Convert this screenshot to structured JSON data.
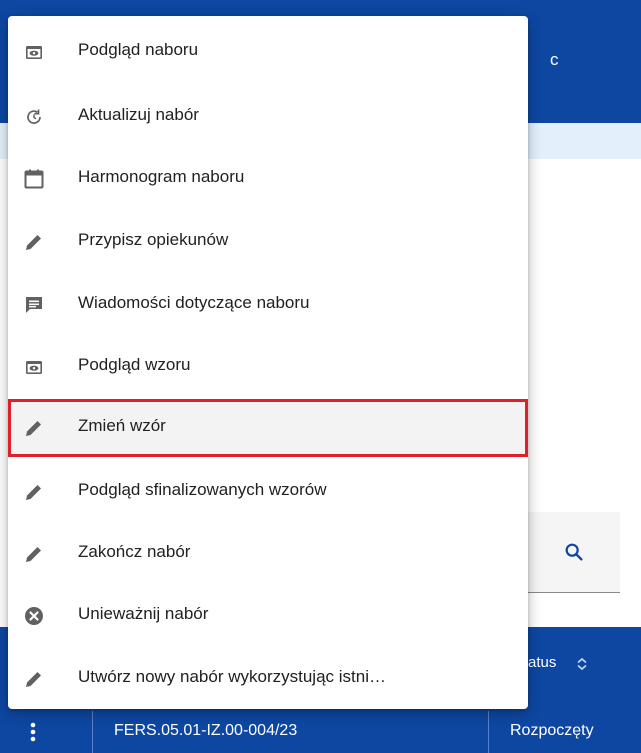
{
  "background": {
    "header_text": "c",
    "table_header": {
      "status_label": "atus"
    },
    "table_row": {
      "code": "FERS.05.01-IZ.00-004/23",
      "status": "Rozpoczęty"
    },
    "search_icon": "search-icon"
  },
  "menu": {
    "items": [
      {
        "label": "Podgląd naboru",
        "icon": "preview-icon"
      },
      {
        "label": "Aktualizuj nabór",
        "icon": "refresh-icon"
      },
      {
        "label": "Harmonogram naboru",
        "icon": "calendar-icon"
      },
      {
        "label": "Przypisz opiekunów",
        "icon": "pencil-icon"
      },
      {
        "label": "Wiadomości dotyczące naboru",
        "icon": "message-icon"
      },
      {
        "label": "Podgląd wzoru",
        "icon": "preview-icon"
      },
      {
        "label": "Zmień wzór",
        "icon": "pencil-icon",
        "highlighted": true
      },
      {
        "label": "Podgląd sfinalizowanych wzorów",
        "icon": "pencil-icon"
      },
      {
        "label": "Zakończ nabór",
        "icon": "pencil-icon"
      },
      {
        "label": "Unieważnij nabór",
        "icon": "cancel-circle-icon"
      },
      {
        "label": "Utwórz nowy nabór wykorzystując istni…",
        "icon": "pencil-icon"
      }
    ]
  },
  "colors": {
    "primary": "#0d47a1",
    "highlight_border": "#e0202a",
    "icon": "#616161",
    "text": "#212121"
  }
}
